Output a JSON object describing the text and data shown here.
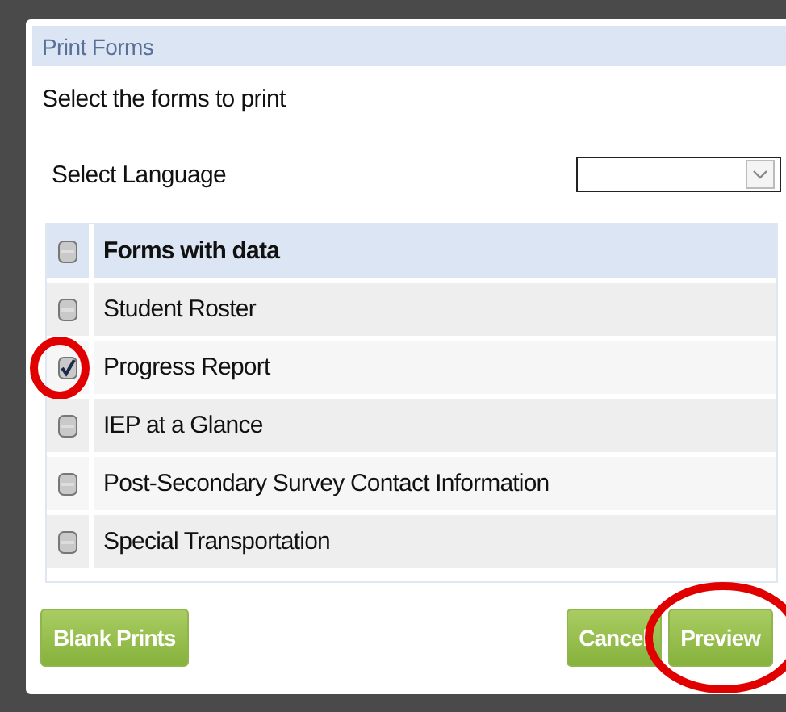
{
  "dialog": {
    "title": "Print Forms",
    "instruction": "Select the forms to print",
    "language": {
      "label": "Select Language"
    }
  },
  "forms": [
    {
      "kind": "header",
      "label": "Forms with data",
      "checked": false,
      "circled": false
    },
    {
      "kind": "item",
      "label": "Student Roster",
      "checked": false,
      "circled": false
    },
    {
      "kind": "item",
      "label": "Progress Report",
      "checked": true,
      "circled": true
    },
    {
      "kind": "item",
      "label": "IEP at a Glance",
      "checked": false,
      "circled": false
    },
    {
      "kind": "item",
      "label": "Post-Secondary Survey Contact Information",
      "checked": false,
      "circled": false
    },
    {
      "kind": "item",
      "label": "Special Transportation",
      "checked": false,
      "circled": false
    }
  ],
  "buttons": [
    {
      "label": "Blank Prints",
      "circled": false
    },
    {
      "label": "Cancel",
      "circled": false
    },
    {
      "label": "Preview",
      "circled": true
    }
  ]
}
